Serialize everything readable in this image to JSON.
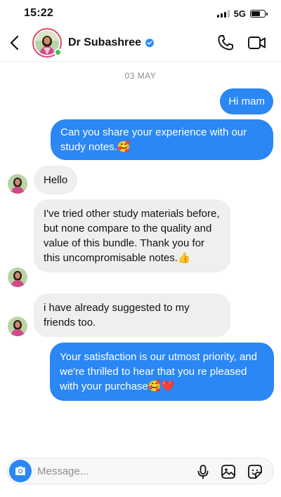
{
  "status": {
    "time": "15:22",
    "network": "5G",
    "battery_level": 0.65
  },
  "header": {
    "contact_name": "Dr Subashree",
    "verified": true,
    "online": true
  },
  "date_separator": "03 MAY",
  "messages": [
    {
      "direction": "outgoing",
      "text": "Hi mam"
    },
    {
      "direction": "outgoing",
      "text": "Can you share your experience with our study notes.🥰"
    },
    {
      "direction": "incoming",
      "text": "Hello"
    },
    {
      "direction": "incoming",
      "text": "I've tried other study materials before, but none compare to the quality and value of this bundle. Thank you for this uncompromisable notes.👍"
    },
    {
      "direction": "incoming",
      "text": "i have already suggested to my friends too."
    },
    {
      "direction": "outgoing",
      "text": "Your satisfaction is our utmost priority, and we're thrilled to hear that you re pleased with your purchase🥰❤️"
    }
  ],
  "composer": {
    "placeholder": "Message..."
  },
  "colors": {
    "accent": "#2a87f4",
    "incoming_bubble": "#efefef",
    "story_ring": "#e04a6a",
    "online": "#3ec14f"
  },
  "icons": [
    "back-icon",
    "verified-icon",
    "phone-icon",
    "video-icon",
    "camera-icon",
    "mic-icon",
    "gallery-icon",
    "sticker-icon"
  ]
}
